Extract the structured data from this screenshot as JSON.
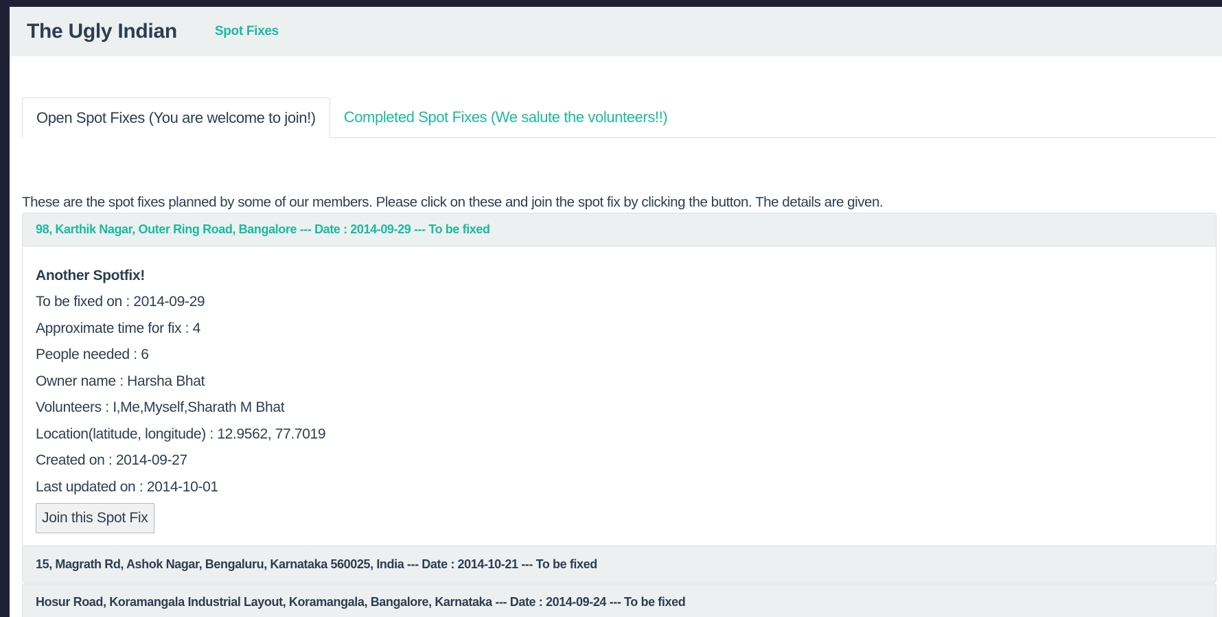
{
  "navbar": {
    "brand": "The Ugly Indian",
    "link": "Spot Fixes"
  },
  "tabs": [
    {
      "label": "Open Spot Fixes (You are welcome to join!)",
      "active": true
    },
    {
      "label": "Completed Spot Fixes (We salute the volunteers!!)",
      "active": false
    }
  ],
  "intro": "These are the spot fixes planned by some of our members. Please click on these and join the spot fix by clicking the button. The details are given.",
  "spotfixes": [
    {
      "heading": "98, Karthik Nagar, Outer Ring Road, Bangalore --- Date : 2014-09-29 --- To be fixed",
      "expanded": true,
      "title": "Another Spotfix!",
      "lines": [
        "To be fixed on : 2014-09-29",
        "Approximate time for fix : 4",
        "People needed : 6",
        "Owner name : Harsha Bhat",
        "Volunteers : I,Me,Myself,Sharath M Bhat",
        "Location(latitude, longitude) : 12.9562, 77.7019",
        "Created on : 2014-09-27",
        "Last updated on : 2014-10-01"
      ],
      "join_label": "Join this Spot Fix"
    },
    {
      "heading": "15, Magrath Rd, Ashok Nagar, Bengaluru, Karnataka 560025, India --- Date : 2014-10-21 --- To be fixed",
      "expanded": false
    },
    {
      "heading": "Hosur Road, Koramangala Industrial Layout, Koramangala, Bangalore, Karnataka --- Date : 2014-09-24 --- To be fixed",
      "expanded": false
    }
  ],
  "colors": {
    "accent": "#18bc9c",
    "text": "#2c3e50",
    "navbar_bg": "#ecf0f1",
    "backdrop": "#1f2035"
  }
}
